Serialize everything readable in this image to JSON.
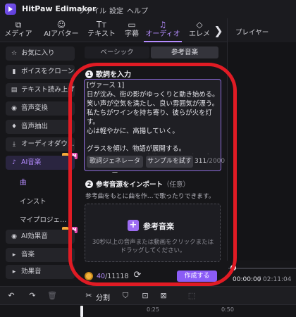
{
  "app": {
    "title": "HitPaw Edimakor",
    "menu": [
      "ファイル",
      "設定",
      "ヘルプ"
    ]
  },
  "toolbar": {
    "tabs": [
      {
        "label": "メディア",
        "icon": "media-icon"
      },
      {
        "label": "AIアバター",
        "icon": "ai-avatar-icon"
      },
      {
        "label": "テキスト",
        "icon": "text-icon"
      },
      {
        "label": "字幕",
        "icon": "subtitle-icon"
      },
      {
        "label": "オーディオ",
        "icon": "music-note-icon",
        "active": true
      },
      {
        "label": "エレメ",
        "icon": "element-icon"
      }
    ],
    "next_glyph": "❯"
  },
  "sidebar": {
    "items": [
      {
        "label": "お気に入り",
        "icon": "star-icon",
        "glyph": "☆"
      },
      {
        "label": "ボイスをクローン",
        "icon": "voice-clone-icon",
        "glyph": "▮"
      },
      {
        "label": "テキスト読み上げ",
        "icon": "tts-icon",
        "glyph": "▤"
      },
      {
        "label": "音声変換",
        "icon": "voice-change-icon",
        "glyph": "◉"
      },
      {
        "label": "音声抽出",
        "icon": "mic-icon",
        "glyph": "♦"
      },
      {
        "label": "オーディオダウ…",
        "icon": "download-icon",
        "glyph": "⤓"
      },
      {
        "label": "AI音楽",
        "icon": "ai-music-icon",
        "glyph": "♪",
        "active": true,
        "badge": "M"
      },
      {
        "label": "AI効果音",
        "icon": "ai-sfx-icon",
        "glyph": "◉",
        "badge": "M"
      },
      {
        "label": "音楽",
        "icon": "music-expand-icon",
        "glyph": "▸"
      },
      {
        "label": "効果音",
        "icon": "sfx-expand-icon",
        "glyph": "▸"
      }
    ],
    "sub_items": [
      {
        "label": "曲",
        "active": true
      },
      {
        "label": "インスト"
      },
      {
        "label": "マイプロジェ…"
      }
    ]
  },
  "segment": {
    "basic": "ベーシック",
    "reference": "参考音楽"
  },
  "step1": {
    "num": "1",
    "title": "歌詞を入力",
    "lyrics": "[ヴァース 1]\n日が沈み、街の影がゆっくりと動き始める。\n笑い声が空気を満たし、良い雰囲気が漂う。\n私たちがワインを持ち寄り、彼らが火を灯す。\n心は軽やかに、高揚していく。\n\nグラスを傾け、物語が展開する。\nすべてのジョークは宝物のように、輝く金のように。",
    "lyric_gen_button": "歌詞ジェネレーター",
    "sample_button": "サンプルを試す",
    "char_count": "311",
    "char_max": "/2000"
  },
  "step2": {
    "num": "2",
    "title": "参考音源をインポート",
    "optional": "（任意）",
    "desc": "参考曲をもとに曲を作…で歌ったりできます。",
    "upload_title": "参考音楽",
    "upload_hint": "30秒以上の音声または動画をクリックまたは\nドラッグしてください。"
  },
  "footer": {
    "credits_used": "40",
    "credits_total": "/11118",
    "create_button": "作成する"
  },
  "preview": {
    "title": "プレイヤー",
    "time_current": "00:00:00",
    "time_sep": "/",
    "time_total": "02:11:04"
  },
  "timeline": {
    "split_label": "分割",
    "ticks": [
      "0:25",
      "0:50"
    ]
  },
  "colors": {
    "accent": "#b58cff",
    "create_button": "#8b5cf6",
    "annotation": "#e01b24"
  }
}
